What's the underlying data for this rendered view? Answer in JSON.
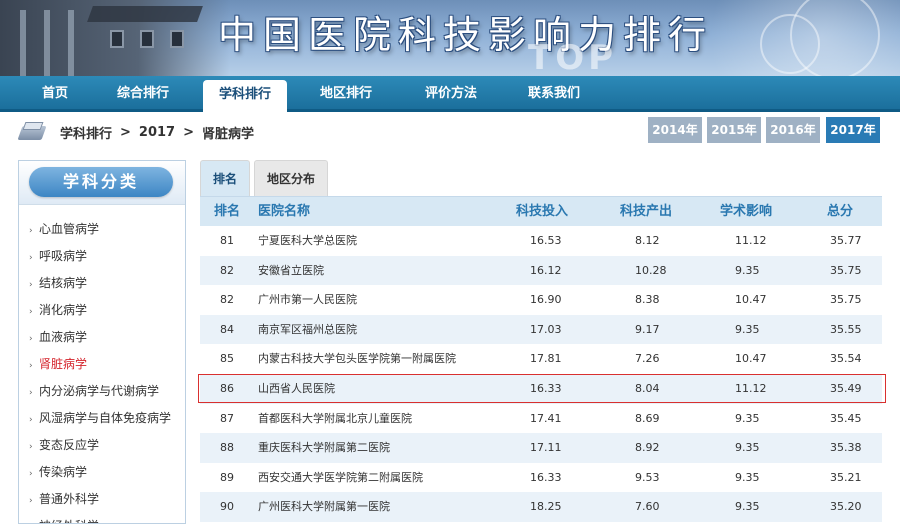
{
  "banner": {
    "title": "中国医院科技影响力排行",
    "watermark": "TOP"
  },
  "nav": {
    "items": [
      {
        "label": "首页"
      },
      {
        "label": "综合排行"
      },
      {
        "label": "学科排行"
      },
      {
        "label": "地区排行"
      },
      {
        "label": "评价方法"
      },
      {
        "label": "联系我们"
      }
    ],
    "active_index": 2
  },
  "breadcrumb": {
    "items": [
      "学科排行",
      "2017",
      "肾脏病学"
    ],
    "separator": ">"
  },
  "years": {
    "items": [
      "2014年",
      "2015年",
      "2016年",
      "2017年"
    ],
    "active": "2017年"
  },
  "sidebar": {
    "title": "学科分类",
    "items": [
      {
        "label": "心血管病学",
        "active": false
      },
      {
        "label": "呼吸病学",
        "active": false
      },
      {
        "label": "结核病学",
        "active": false
      },
      {
        "label": "消化病学",
        "active": false
      },
      {
        "label": "血液病学",
        "active": false
      },
      {
        "label": "肾脏病学",
        "active": true
      },
      {
        "label": "内分泌病学与代谢病学",
        "active": false
      },
      {
        "label": "风湿病学与自体免疫病学",
        "active": false
      },
      {
        "label": "变态反应学",
        "active": false
      },
      {
        "label": "传染病学",
        "active": false
      },
      {
        "label": "普通外科学",
        "active": false
      },
      {
        "label": "神经外科学",
        "active": false
      }
    ]
  },
  "tabs": [
    {
      "label": "排名",
      "active": true
    },
    {
      "label": "地区分布",
      "active": false
    }
  ],
  "table": {
    "headers": [
      "排名",
      "医院名称",
      "科技投入",
      "科技产出",
      "学术影响",
      "总分"
    ],
    "rows": [
      {
        "rank": "81",
        "name": "宁夏医科大学总医院",
        "input": "16.53",
        "output": "8.12",
        "impact": "11.12",
        "total": "35.77"
      },
      {
        "rank": "82",
        "name": "安徽省立医院",
        "input": "16.12",
        "output": "10.28",
        "impact": "9.35",
        "total": "35.75"
      },
      {
        "rank": "82",
        "name": "广州市第一人民医院",
        "input": "16.90",
        "output": "8.38",
        "impact": "10.47",
        "total": "35.75"
      },
      {
        "rank": "84",
        "name": "南京军区福州总医院",
        "input": "17.03",
        "output": "9.17",
        "impact": "9.35",
        "total": "35.55"
      },
      {
        "rank": "85",
        "name": "内蒙古科技大学包头医学院第一附属医院",
        "input": "17.81",
        "output": "7.26",
        "impact": "10.47",
        "total": "35.54"
      },
      {
        "rank": "86",
        "name": "山西省人民医院",
        "input": "16.33",
        "output": "8.04",
        "impact": "11.12",
        "total": "35.49"
      },
      {
        "rank": "87",
        "name": "首都医科大学附属北京儿童医院",
        "input": "17.41",
        "output": "8.69",
        "impact": "9.35",
        "total": "35.45"
      },
      {
        "rank": "88",
        "name": "重庆医科大学附属第二医院",
        "input": "17.11",
        "output": "8.92",
        "impact": "9.35",
        "total": "35.38"
      },
      {
        "rank": "89",
        "name": "西安交通大学医学院第二附属医院",
        "input": "16.33",
        "output": "9.53",
        "impact": "9.35",
        "total": "35.21"
      },
      {
        "rank": "90",
        "name": "广州医科大学附属第一医院",
        "input": "18.25",
        "output": "7.60",
        "impact": "9.35",
        "total": "35.20"
      }
    ],
    "highlight_row_index": 5
  },
  "colors": {
    "nav_bg": "#1b6f9c",
    "header_text": "#2a78b0",
    "row_alt": "#eaf2f9",
    "highlight": "#d9302f",
    "active_side": "#d4232b",
    "year_active": "#2a7bb5",
    "year_inactive": "#9fb1c4"
  },
  "icons": {
    "breadcrumb": "book-stack-icon",
    "side_bullet": "chevron-right-icon"
  }
}
